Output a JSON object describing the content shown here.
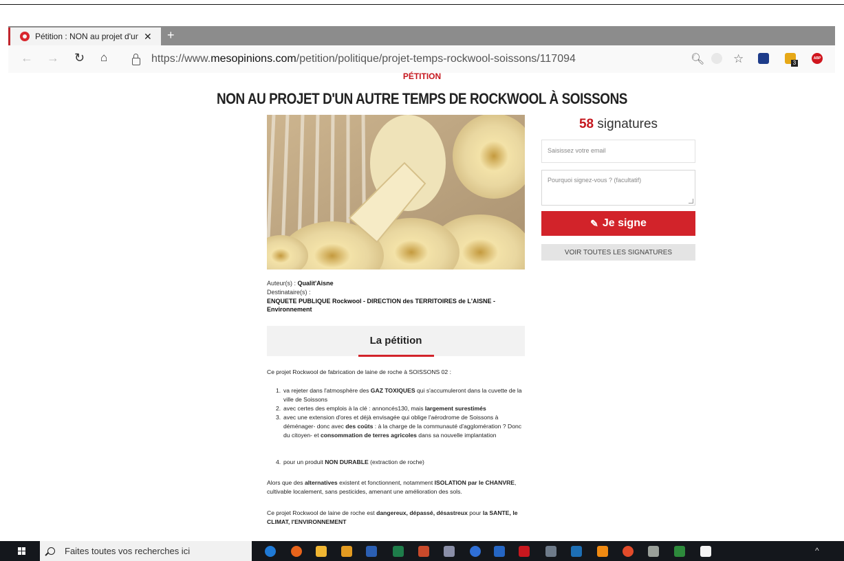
{
  "browser": {
    "tab_title": "Pétition : NON au projet d'un autre temps de Rockwool à Soissons",
    "tab_title_visible": "Pétition : NON au projet d'un aut",
    "new_tab": "+",
    "url_prefix": "https://www.",
    "url_domain": "mesopinions.com",
    "url_path": "/petition/politique/projet-temps-rockwool-soissons/117094",
    "ext_badge": "3",
    "abp": "ABP"
  },
  "page": {
    "tag": "PÉTITION",
    "title": "NON AU PROJET D'UN AUTRE TEMPS DE ROCKWOOL À SOISSONS",
    "signatures_count": "58",
    "signatures_word": "signatures",
    "email_placeholder": "Saisissez votre email",
    "reason_placeholder": "Pourquoi signez-vous ? (facultatif)",
    "sign_label": "Je signe",
    "all_signatures_label": "VOIR TOUTES LES SIGNATURES",
    "author_label": "Auteur(s) :",
    "author": "Qualit'Aisne",
    "recipients_label": "Destinataire(s) :",
    "recipients": "ENQUETE PUBLIQUE Rockwool - DIRECTION des TERRITOIRES de L'AISNE - Environnement",
    "section_title": "La pétition",
    "intro": "Ce projet Rockwool de fabrication de laine de roche à SOISSONS 02 :",
    "items": [
      {
        "n": "1.",
        "a": "va rejeter dans l'atmosphère des ",
        "b": "GAZ TOXIQUES",
        "c": " qui s'accumuleront dans la cuvette de la ville de Soissons"
      },
      {
        "n": "2.",
        "a": "avec certes des emplois à la clé : annoncés130, mais ",
        "b": "largement surestimés",
        "c": ""
      },
      {
        "n": "3.",
        "a": "avec une extension d'ores et déjà envisagée qui oblige l'aérodrome de Soissons à déménager- donc avec ",
        "b": "des coûts",
        "c": " : à la charge de la communauté d'agglomération ? Donc du citoyen- et ",
        "d": "consommation de terres agricoles",
        "e": " dans sa nouvelle implantation"
      },
      {
        "n": "4.",
        "a": "pour un produit ",
        "b": "NON DURABLE",
        "c": " (extraction de roche)"
      }
    ],
    "para2": {
      "a": "Alors que des ",
      "b": "alternatives",
      "c": " existent et fonctionnent, notamment ",
      "d": "ISOLATION par le CHANVRE",
      "e": ", cultivable localement, sans pesticides, amenant une amélioration des sols."
    },
    "para3": {
      "a": "Ce projet Rockwool de laine de roche est ",
      "b": "dangereux, dépassé, désastreux",
      "c": " pour ",
      "d": "la SANTE, le CLIMAT, l'ENVIRONNEMENT"
    }
  },
  "taskbar": {
    "search_placeholder": "Faites toutes vos recherches ici"
  },
  "colors": {
    "accent": "#d2232a",
    "tab_strip": "#8c8c8c",
    "taskbar": "#14171c"
  }
}
